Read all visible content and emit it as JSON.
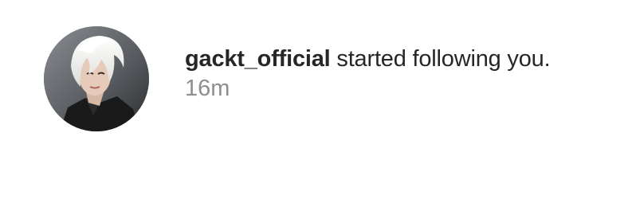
{
  "notification": {
    "avatar_icon": "profile-photo",
    "username": "gackt_official",
    "action_text": " started following you.",
    "timestamp": "16m"
  },
  "colors": {
    "text_primary": "#262626",
    "text_secondary": "#8e8e8e",
    "background": "#ffffff"
  }
}
